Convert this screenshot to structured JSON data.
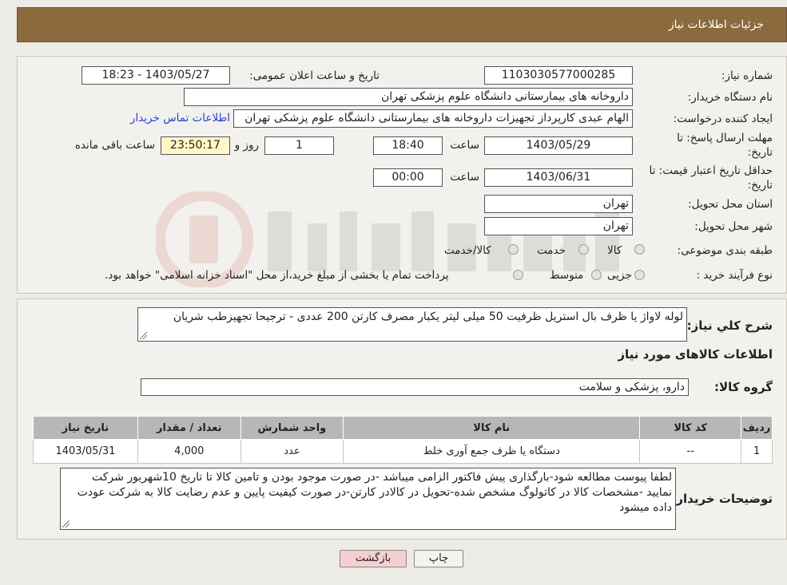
{
  "header": {
    "title": "جزئیات اطلاعات نیاز"
  },
  "form": {
    "need_number": {
      "label": "شماره نیاز:",
      "value": "1103030577000285"
    },
    "announce_datetime": {
      "label": "تاریخ و ساعت اعلان عمومی:",
      "value": "1403/05/27 - 18:23"
    },
    "buyer_org": {
      "label": "نام دستگاه خریدار:",
      "value": "داروخانه های بیمارستانی دانشگاه علوم پزشکی تهران"
    },
    "requester": {
      "label": "ایجاد کننده درخواست:",
      "value": "الهام عبدی کارپرداز تجهیزات داروخانه های بیمارستانی دانشگاه علوم پزشکی تهران",
      "contact_link": "اطلاعات تماس خریدار"
    },
    "response_deadline": {
      "label_line1": "مهلت ارسال پاسخ: تا",
      "label_line2": "تاریخ:",
      "date": "1403/05/29",
      "time_label": "ساعت",
      "time": "18:40",
      "days": "1",
      "days_label": "روز و",
      "remaining": "23:50:17",
      "remaining_label": "ساعت باقی مانده"
    },
    "price_validity": {
      "label_line1": "حداقل تاریخ اعتبار قیمت: تا",
      "label_line2": "تاریخ:",
      "date": "1403/06/31",
      "time_label": "ساعت",
      "time": "00:00"
    },
    "delivery_province": {
      "label": "استان محل تحویل:",
      "value": "تهران"
    },
    "delivery_city": {
      "label": "شهر محل تحویل:",
      "value": "تهران"
    },
    "category": {
      "label": "طبقه بندی موضوعی:",
      "options": [
        "کالا",
        "خدمت",
        "کالا/خدمت"
      ]
    },
    "purchase_type": {
      "label": "نوع فرآیند خرید :",
      "options": [
        "جزیی",
        "متوسط"
      ],
      "note": "پرداخت تمام یا بخشی از مبلغ خرید،از محل \"اسناد خزانه اسلامی\" خواهد بود."
    }
  },
  "summary": {
    "label": "شرح کلي نياز:",
    "value": "لوله لاواژ یا ظرف بال استریل  ظرفیت  50 میلی لیتر  یکبار مصرف  کارتن 200 عددی - ترجیحا تجهیزطب شریان"
  },
  "items_section": {
    "title": "اطلاعات کالاهای مورد نیاز"
  },
  "goods_group": {
    "label": "گروه کالا:",
    "value": "دارو، پزشکی و سلامت"
  },
  "table": {
    "headers": [
      "ردیف",
      "کد کالا",
      "نام کالا",
      "واحد شمارش",
      "تعداد / مقدار",
      "تاریخ نیاز"
    ],
    "rows": [
      [
        "1",
        "--",
        "دستگاه یا ظرف جمع آوری خلط",
        "عدد",
        "4,000",
        "1403/05/31"
      ]
    ]
  },
  "buyer_notes": {
    "label": "توضیحات خریدار:",
    "value": "لطفا پیوست مطالعه شود-بارگذاری پیش فاکتور الزامی میباشد -در صورت موجود بودن و تامین کالا تا تاریخ 10شهریور شرکت نمایید -مشخصات کالا در کاتولوگ مشخص شده-تحویل در کالادر کارتن-در صورت کیفیت پایین و عدم رضایت کالا به شرکت عودت داده میشود"
  },
  "buttons": {
    "print": "چاپ",
    "back": "بازگشت"
  },
  "colors": {
    "header_bg": "#8b6a3e",
    "link": "#2a3fd4",
    "back_button_bg": "#f6d0d0",
    "remaining_bg": "#fff8c6"
  }
}
